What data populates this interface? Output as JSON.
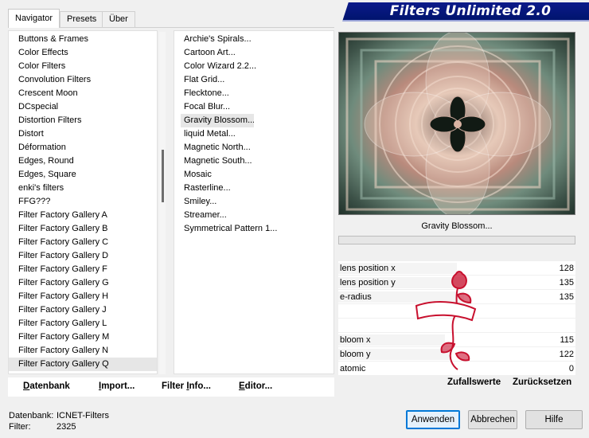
{
  "tabs": [
    {
      "label": "Navigator",
      "active": true
    },
    {
      "label": "Presets",
      "active": false
    },
    {
      "label": "Über",
      "active": false
    }
  ],
  "title": "Filters Unlimited 2.0",
  "categories": [
    "Buttons & Frames",
    "Color Effects",
    "Color Filters",
    "Convolution Filters",
    "Crescent Moon",
    "DCspecial",
    "Distortion Filters",
    "Distort",
    "Déformation",
    "Edges, Round",
    "Edges, Square",
    "enki's filters",
    "FFG???",
    "Filter Factory Gallery A",
    "Filter Factory Gallery B",
    "Filter Factory Gallery C",
    "Filter Factory Gallery D",
    "Filter Factory Gallery F",
    "Filter Factory Gallery G",
    "Filter Factory Gallery H",
    "Filter Factory Gallery J",
    "Filter Factory Gallery L",
    "Filter Factory Gallery M",
    "Filter Factory Gallery N",
    "Filter Factory Gallery Q"
  ],
  "selected_category": "Filter Factory Gallery Q",
  "filters": [
    "Archie's Spirals...",
    "Cartoon Art...",
    "Color Wizard 2.2...",
    "Flat Grid...",
    "Flecktone...",
    "Focal Blur...",
    "Gravity Blossom...",
    "liquid Metal...",
    "Magnetic North...",
    "Magnetic South...",
    "Mosaic",
    "Rasterline...",
    "Smiley...",
    "Streamer...",
    "Symmetrical Pattern 1..."
  ],
  "selected_filter": "Gravity Blossom...",
  "toolbar": {
    "datenbank_u": "D",
    "datenbank_rest": "atenbank",
    "import_u": "I",
    "import_rest": "mport...",
    "info_pre": "Filter ",
    "info_u": "I",
    "info_rest": "nfo...",
    "editor_u": "E",
    "editor_rest": "ditor..."
  },
  "preview_filter_name": "Gravity Blossom...",
  "params": [
    {
      "label": "lens position x",
      "value": "128",
      "fraction": 0.5
    },
    {
      "label": "lens position y",
      "value": "135",
      "fraction": 0.53
    },
    {
      "label": "e-radius",
      "value": "135",
      "fraction": 0.53
    },
    {
      "label": "",
      "value": "",
      "fraction": 0
    },
    {
      "label": "",
      "value": "",
      "fraction": 0
    },
    {
      "label": "bloom x",
      "value": "115",
      "fraction": 0.45
    },
    {
      "label": "bloom y",
      "value": "122",
      "fraction": 0.48
    },
    {
      "label": "atomic",
      "value": "0",
      "fraction": 0
    }
  ],
  "random_values": "Zufallswerte",
  "reset": "Zurücksetzen",
  "status": {
    "db_label": "Datenbank:",
    "db_value": "ICNET-Filters",
    "filter_label": "Filter:",
    "filter_value": "2325"
  },
  "buttons": {
    "apply": "Anwenden",
    "cancel": "Abbrechen",
    "help": "Hilfe"
  },
  "colors": {
    "banner": "#0c1a8a",
    "accent": "#0078d7",
    "watermark": "#c8102e"
  }
}
